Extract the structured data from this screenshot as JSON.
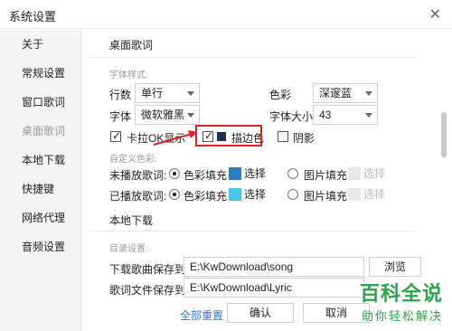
{
  "window": {
    "title": "系统设置",
    "close_glyph": "✕"
  },
  "sidebar": {
    "items": [
      {
        "label": "关于"
      },
      {
        "label": "常规设置"
      },
      {
        "label": "窗口歌词"
      },
      {
        "label": "桌面歌词",
        "active": true
      },
      {
        "label": "本地下载"
      },
      {
        "label": "快捷键"
      },
      {
        "label": "网络代理"
      },
      {
        "label": "音频设置"
      }
    ]
  },
  "desktop_lyrics": {
    "title": "桌面歌词",
    "font_style_heading": "字体样式:",
    "rows_label": "行数",
    "rows_value": "单行",
    "color_label": "色彩",
    "color_value": "深邃蓝",
    "font_label": "字体",
    "font_value": "微软雅黑",
    "size_label": "字体大小",
    "size_value": "43",
    "karaoke_label": "卡拉OK显示",
    "outline_label": "描边色",
    "shadow_label": "阴影",
    "custom_color_heading": "自定义色彩:",
    "unplayed_label": "未播放歌词:",
    "played_label": "已播放歌词:",
    "color_fill_label": "色彩填充",
    "image_fill_label": "图片填充",
    "select_label": "选择"
  },
  "local_download": {
    "title": "本地下载",
    "dir_heading": "目录设置:",
    "song_dir_label": "下载歌曲保存到:",
    "song_dir_value": "E:\\KwDownload\\song",
    "lyric_dir_label": "歌词文件保存到:",
    "lyric_dir_value": "E:\\KwDownload\\Lyric",
    "browse_label": "浏览"
  },
  "footer": {
    "reset_label": "全部重置",
    "confirm_label": "确认",
    "cancel_label": "取消"
  },
  "watermark": {
    "big": "百科全说",
    "small": "助你轻松解决"
  },
  "colors": {
    "accent_red": "#e02020",
    "swatch_blue": "#2a7fc0",
    "swatch_cyan": "#45c8e8",
    "swatch_disabled": "#e8e8e8",
    "watermark_green": "#2aa64a",
    "outline_swatch": "#203050"
  }
}
